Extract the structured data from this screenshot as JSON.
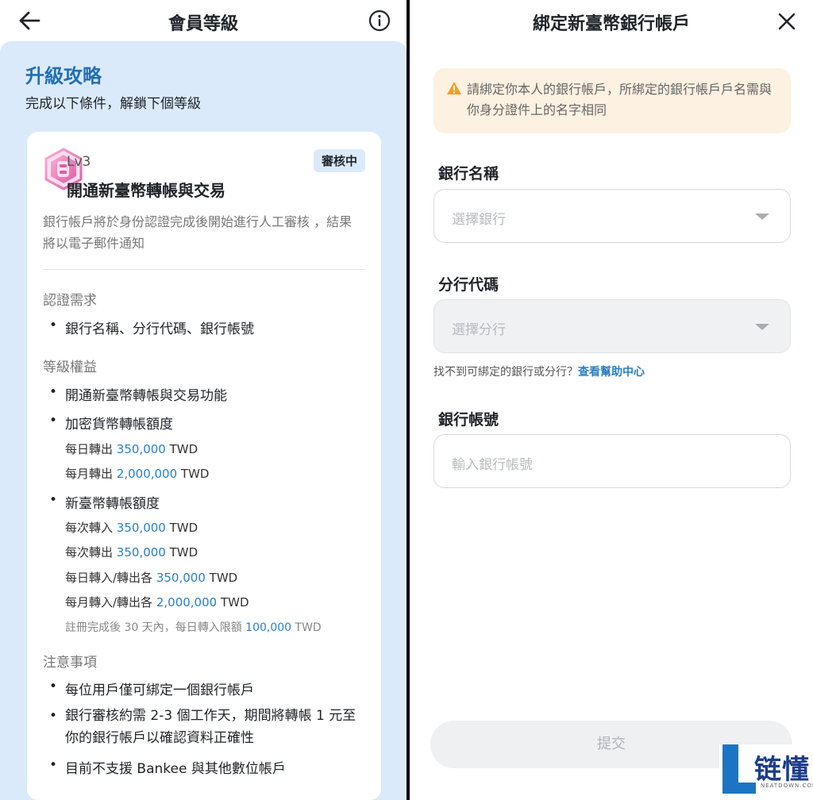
{
  "left": {
    "header_title": "會員等級",
    "guide_title": "升級攻略",
    "guide_sub": "完成以下條件，解鎖下個等級",
    "card": {
      "level": "Lv3",
      "level_title": "開通新臺幣轉帳與交易",
      "badge": "審核中",
      "desc": "銀行帳戶將於身份認證完成後開始進行人工審核 ，結果將以電子郵件通知",
      "sec_requirements": "認證需求",
      "req_item": "銀行名稱、分行代碼、銀行帳號",
      "sec_benefits": "等級權益",
      "benefit_1": "開通新臺幣轉帳與交易功能",
      "benefit_2": "加密貨幣轉帳額度",
      "b2_daily_label": "每日轉出",
      "b2_daily_amount": "350,000",
      "b2_monthly_label": "每月轉出",
      "b2_monthly_amount": "2,000,000",
      "currency": "TWD",
      "benefit_3": "新臺幣轉帳額度",
      "b3_per_in_label": "每次轉入",
      "b3_per_in_amount": "350,000",
      "b3_per_out_label": "每次轉出",
      "b3_per_out_amount": "350,000",
      "b3_daily_label": "每日轉入/轉出各",
      "b3_daily_amount": "350,000",
      "b3_monthly_label": "每月轉入/轉出各",
      "b3_monthly_amount": "2,000,000",
      "note_label": "註冊完成後 30 天內，每日轉入限額",
      "note_amount": "100,000",
      "sec_notes": "注意事項",
      "note_1": "每位用戶僅可綁定一個銀行帳戶",
      "note_2": "銀行審核約需 2-3 個工作天，期間將轉帳 1 元至你的銀行帳戶以確認資料正確性",
      "note_3": "目前不支援 Bankee 與其他數位帳戶"
    }
  },
  "right": {
    "header_title": "綁定新臺幣銀行帳戶",
    "warning": "請綁定你本人的銀行帳戶，所綁定的銀行帳戶戶名需與你身分證件上的名字相同",
    "bank_label": "銀行名稱",
    "bank_placeholder": "選擇銀行",
    "branch_label": "分行代碼",
    "branch_placeholder": "選擇分行",
    "help_text": "找不到可綁定的銀行或分行？",
    "help_link": "查看幫助中心",
    "account_label": "銀行帳號",
    "account_placeholder": "輸入銀行帳號",
    "submit": "提交"
  },
  "watermark": {
    "text": "链懂",
    "sub": "NEATDOWN.COM"
  },
  "colors": {
    "accent_blue": "#1f6fb5",
    "number_blue": "#2a80c6",
    "panel_blue": "#dbeafb",
    "warning_bg": "#fdf1e1",
    "warning_icon": "#f0a020"
  },
  "icons": [
    "back-arrow-icon",
    "info-icon",
    "level-badge-icon",
    "close-icon",
    "warning-icon",
    "chevron-down-icon"
  ]
}
